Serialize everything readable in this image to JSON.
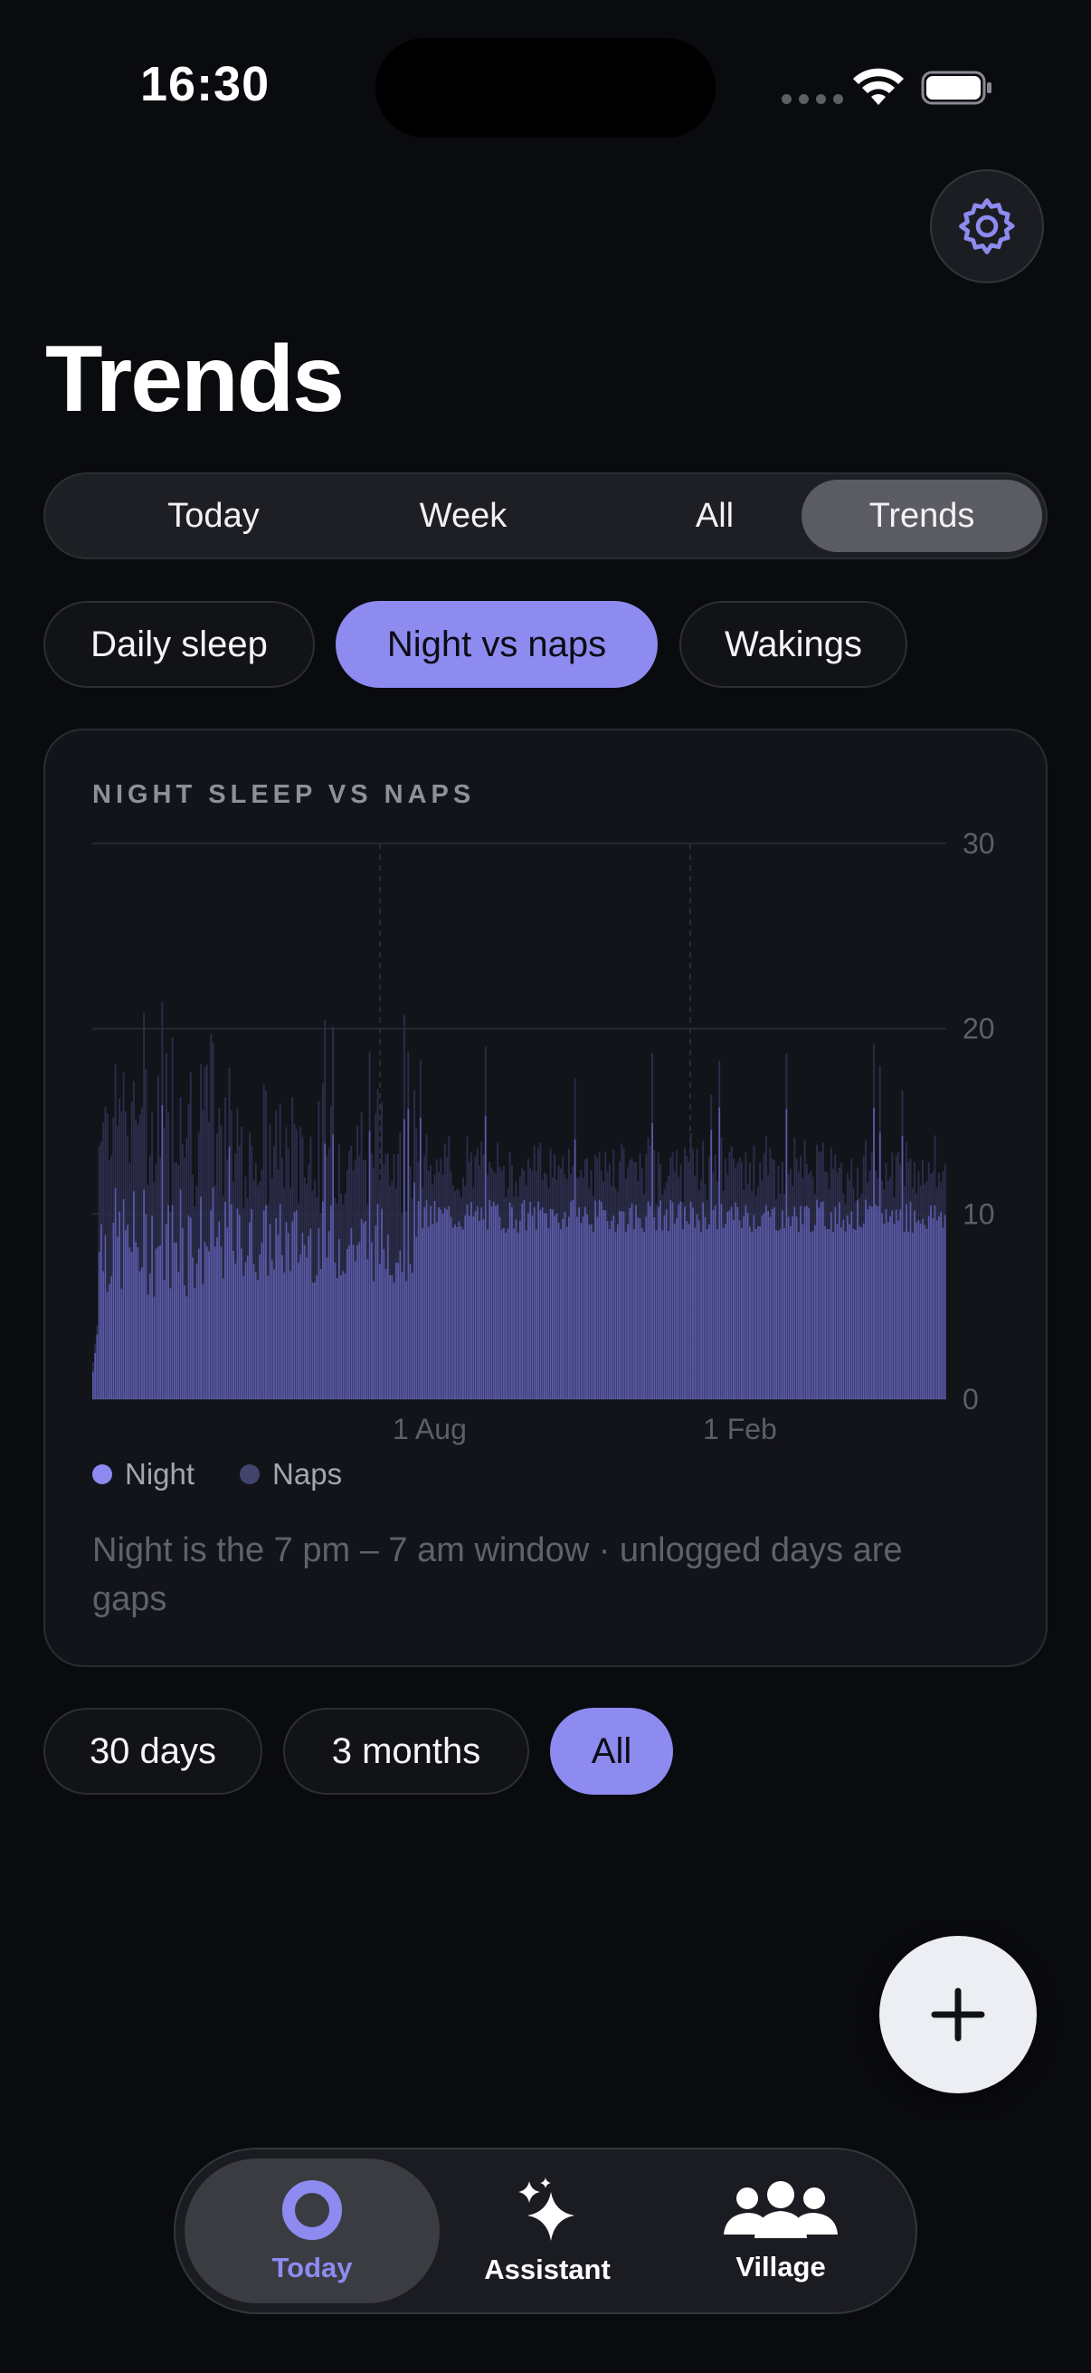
{
  "status_bar": {
    "time": "16:30"
  },
  "header": {
    "title": "Trends"
  },
  "segments": [
    {
      "label": "Today",
      "active": false
    },
    {
      "label": "Week",
      "active": false
    },
    {
      "label": "All",
      "active": false
    },
    {
      "label": "Trends",
      "active": true
    }
  ],
  "chart_tabs": [
    {
      "label": "Daily sleep",
      "active": false
    },
    {
      "label": "Night vs naps",
      "active": true
    },
    {
      "label": "Wakings",
      "active": false
    }
  ],
  "card": {
    "title": "NIGHT SLEEP VS NAPS",
    "legend": [
      {
        "label": "Night",
        "color": "#8d8bf0"
      },
      {
        "label": "Naps",
        "color": "#43446e"
      }
    ],
    "note": "Night is the 7 pm – 7 am window · unlogged days are gaps"
  },
  "chart_data": {
    "type": "bar",
    "stacked": true,
    "y_ticks": [
      "30",
      "20",
      "10",
      "0"
    ],
    "ylim": [
      0,
      30
    ],
    "x_ticks": [
      "1 Aug",
      "1 Feb"
    ],
    "grid": true,
    "legend_placement": "bottom-left",
    "series": [
      {
        "name": "Night",
        "color": "#5a5aa8",
        "profile": {
          "segments": [
            {
              "from_day": 0,
              "to_day": 60,
              "mean": 8.5,
              "jitter": 3.0
            },
            {
              "from_day": 60,
              "to_day": 160,
              "mean": 8.5,
              "jitter": 2.2
            },
            {
              "from_day": 160,
              "to_day": 420,
              "mean": 9.9,
              "jitter": 0.9
            }
          ]
        }
      },
      {
        "name": "Naps",
        "color": "#2c2d4a",
        "profile": {
          "segments": [
            {
              "from_day": 0,
              "to_day": 60,
              "mean": 7.0,
              "jitter": 3.0
            },
            {
              "from_day": 60,
              "to_day": 160,
              "mean": 5.0,
              "jitter": 2.0
            },
            {
              "from_day": 160,
              "to_day": 420,
              "mean": 2.6,
              "jitter": 1.2
            }
          ]
        }
      }
    ],
    "days": 420
  },
  "ranges": [
    {
      "label": "30 days",
      "active": false
    },
    {
      "label": "3 months",
      "active": false
    },
    {
      "label": "All",
      "active": true
    }
  ],
  "fab": {
    "icon": "plus-icon"
  },
  "tabbar": [
    {
      "label": "Today",
      "icon": "today-ring-icon",
      "active": true
    },
    {
      "label": "Assistant",
      "icon": "sparkles-icon",
      "active": false
    },
    {
      "label": "Village",
      "icon": "people-icon",
      "active": false
    }
  ]
}
